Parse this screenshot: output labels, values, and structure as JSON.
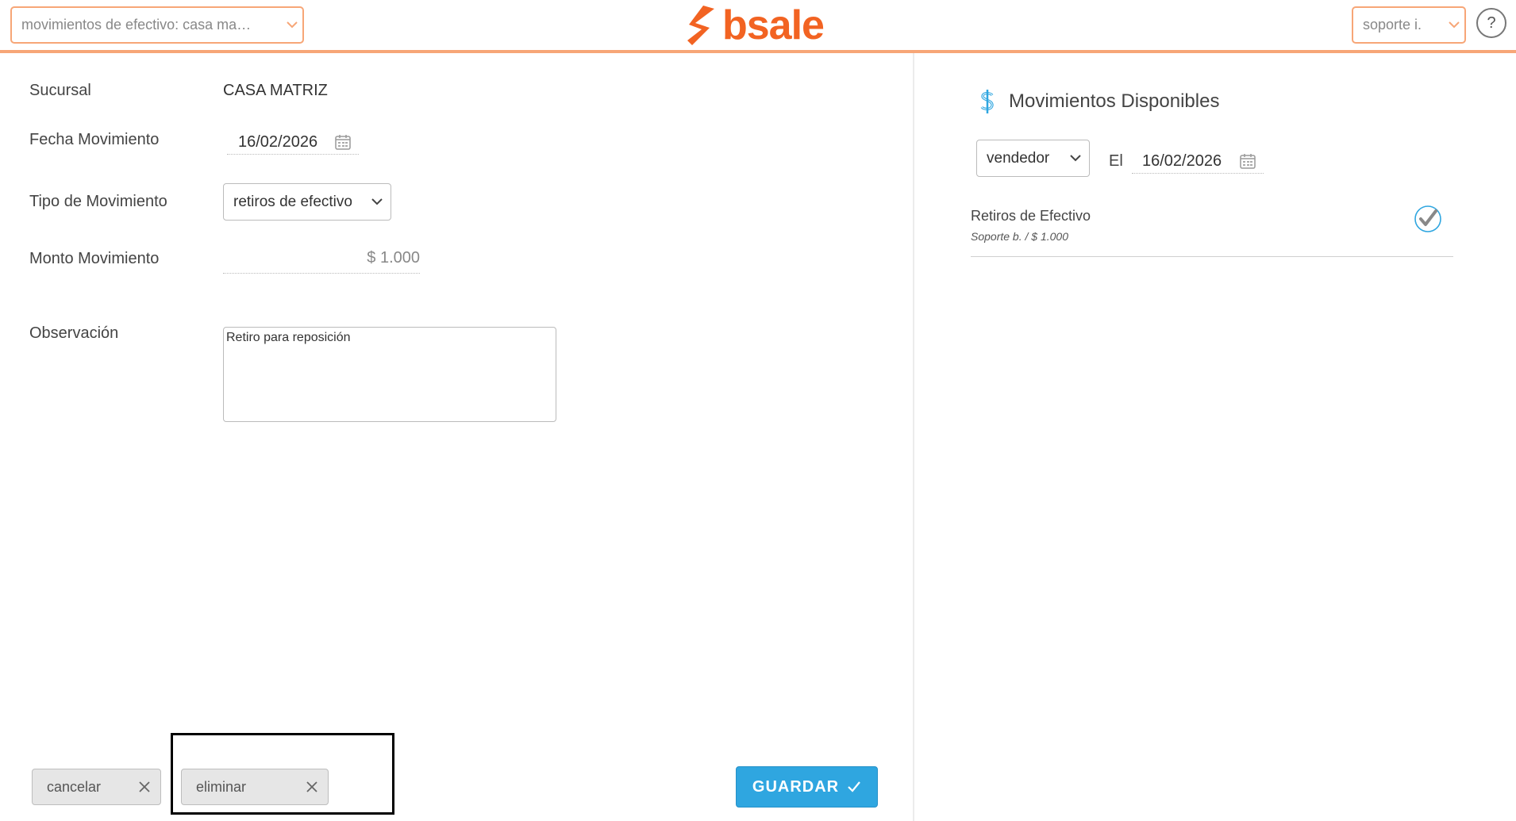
{
  "header": {
    "module_select": "movimientos de efectivo: casa ma…",
    "brand": "bsale",
    "user_select": "soporte i.",
    "help_label": "?"
  },
  "form": {
    "sucursal_label": "Sucursal",
    "sucursal_value": "CASA MATRIZ",
    "fecha_label": "Fecha Movimiento",
    "fecha_value": "16/02/2026",
    "tipo_label": "Tipo de Movimiento",
    "tipo_value": "retiros de efectivo",
    "monto_label": "Monto Movimiento",
    "monto_value": "$ 1.000",
    "observacion_label": "Observación",
    "observacion_value": "Retiro para reposición"
  },
  "actions": {
    "cancel_label": "cancelar",
    "delete_label": "eliminar",
    "save_label": "GUARDAR"
  },
  "right_panel": {
    "title": "Movimientos Disponibles",
    "filter_select": "vendedor",
    "date_prefix": "El",
    "date_value": "16/02/2026",
    "items": [
      {
        "name": "Retiros de Efectivo",
        "detail": "Soporte b. / $ 1.000"
      }
    ]
  },
  "colors": {
    "brand_orange": "#f26322",
    "accent_border": "#f7a677",
    "save_blue": "#2fa6e0",
    "dollar_icon": "#2fa6e0"
  },
  "icons": [
    "chevron-down-icon",
    "help-icon",
    "calendar-icon",
    "dollar-icon",
    "close-icon",
    "check-icon",
    "check-circle-icon"
  ]
}
